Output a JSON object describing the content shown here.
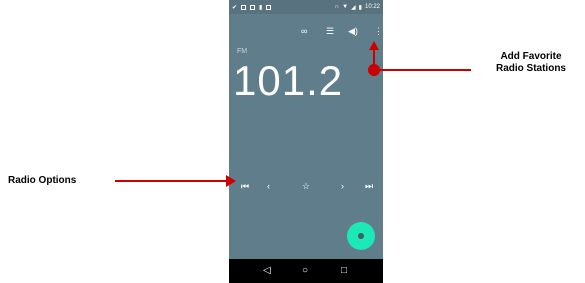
{
  "status_bar": {
    "time": "10:22"
  },
  "toolbar": {
    "icons": [
      "link-icon",
      "list-icon",
      "speaker-icon",
      "more-vert-icon"
    ]
  },
  "radio": {
    "band": "FM",
    "frequency": "101.2"
  },
  "controls": {
    "icons": [
      "skip-previous-icon",
      "chevron-left-icon",
      "star-icon",
      "chevron-right-icon",
      "skip-next-icon"
    ]
  },
  "annotations": {
    "add_favorite": "Add Favorite\nRadio Stations",
    "radio_options": "Radio Options"
  },
  "colors": {
    "screen_bg": "#607d8b",
    "fab": "#1de9b6",
    "annotation_arrow": "#cc0000"
  }
}
